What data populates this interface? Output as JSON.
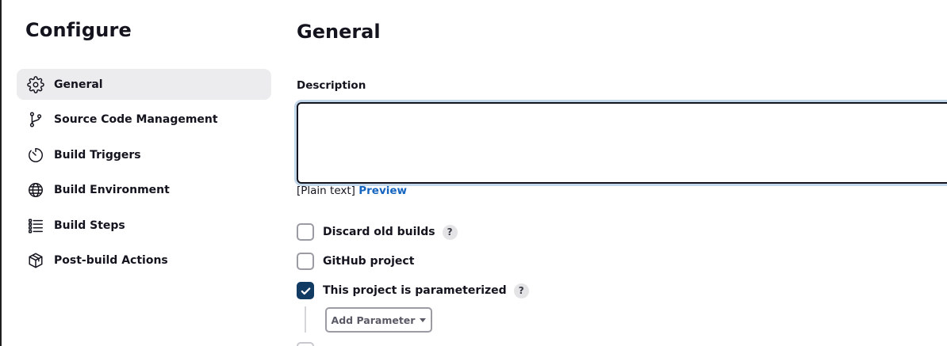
{
  "sidebar": {
    "title": "Configure",
    "items": [
      {
        "label": "General",
        "icon": "gear-icon",
        "active": true
      },
      {
        "label": "Source Code Management",
        "icon": "git-branch-icon",
        "active": false
      },
      {
        "label": "Build Triggers",
        "icon": "timer-icon",
        "active": false
      },
      {
        "label": "Build Environment",
        "icon": "globe-icon",
        "active": false
      },
      {
        "label": "Build Steps",
        "icon": "list-icon",
        "active": false
      },
      {
        "label": "Post-build Actions",
        "icon": "package-icon",
        "active": false
      }
    ]
  },
  "main": {
    "title": "General",
    "description": {
      "label": "Description",
      "value": "",
      "format_text": "[Plain text]",
      "preview_label": "Preview"
    },
    "options": [
      {
        "label": "Discard old builds",
        "checked": false,
        "help": "?"
      },
      {
        "label": "GitHub project",
        "checked": false
      },
      {
        "label": "This project is parameterized",
        "checked": true,
        "help": "?"
      }
    ],
    "add_parameter_label": "Add Parameter"
  },
  "colors": {
    "accent_link": "#1565c0",
    "checked_box": "#123b63",
    "active_nav_bg": "#ececee",
    "focus_ring": "#c3d7ea"
  }
}
